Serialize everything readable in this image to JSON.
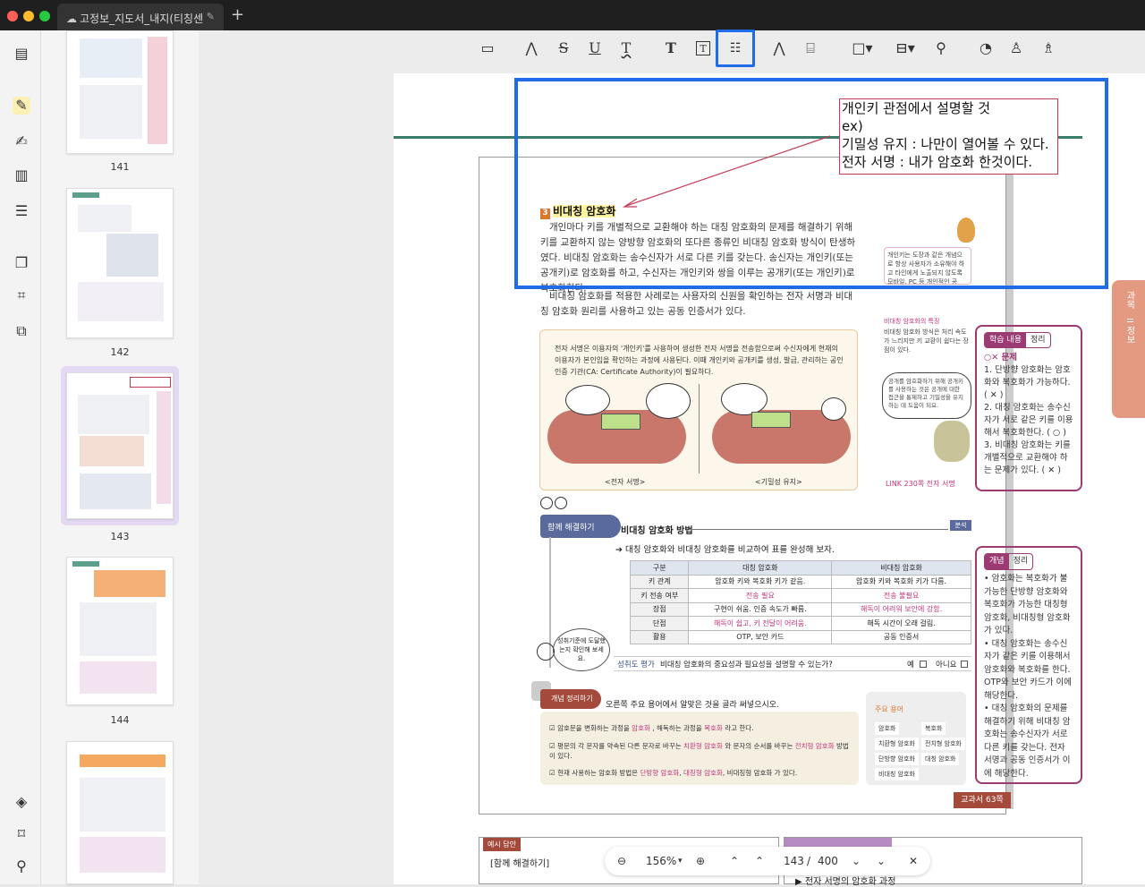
{
  "window": {
    "tab_title": "고정보_지도서_내지(티칭센",
    "new_tab": "+"
  },
  "thumbnails": [
    {
      "label": "141"
    },
    {
      "label": "142"
    },
    {
      "label": "143"
    },
    {
      "label": "144"
    }
  ],
  "toolbar": {
    "tools": [
      "note-icon",
      "highlighter-icon",
      "strikethrough-icon",
      "underline-icon",
      "squiggly-icon",
      "text-icon",
      "textbox-icon",
      "callout-icon",
      "pencil-icon",
      "eraser-icon",
      "shape-icon",
      "measure-icon",
      "attachment-icon",
      "sticker-icon",
      "stamp-icon",
      "signature-icon"
    ]
  },
  "comment": {
    "line1": "개인키 관점에서 설명할 것",
    "line2": "ex)",
    "line3": "기밀성 유지 : 나만이 열어볼 수 있다.",
    "line4": "전자 서명 : 내가 암호화 한것이다."
  },
  "page": {
    "section_num": "3",
    "section_title": "비대칭 암호화",
    "para1": "개인마다 키를 개별적으로 교환해야 하는 대칭 암호화의 문제를 해결하기 위해 키를 교환하지 않는 양방향 암호화의 또다른 종류인 비대칭 암호화 방식이 탄생하였다. 비대칭 암호화는 송수신자가 서로 다른 키를 갖는다. 송신자는 개인키(또는 공개키)로 암호화를 하고, 수신자는 개인키와 쌍을 이루는 공개키(또는 개인키)로 복호화한다.",
    "para2": "비대칭 암호화를 적용한 사례로는 사용자의 신원을 확인하는 전자 서명과 비대칭 암호화 원리를 사용하고 있는 공동 인증서가 있다.",
    "sidenote1": "개인키는 도장과 같은 개념으로 항상 사용자가 소유해야 하고 타인에게 노출되지 않도록 모바일, PC 등 개인적인 공",
    "sidenote2_title": "비대칭 암호화의 특징",
    "sidenote2": "비대칭 암호화 방식은 처리 속도가 느리지만 키 교환이 쉽다는 장점이 있다.",
    "bubble_side": "공개를 암호화하기 위해 공개키를 사용하는 것은 공개에 대한 접근을 통제하고 기밀성을 유지하는 데 도움이 되요.",
    "link_text": "LINK 230쪽 전자 서명",
    "tab_side_a": "과목",
    "tab_side_b": "II 정보",
    "cartoon_text": "전자 서명은 이용자의 '개인키'를 사용하여 생성한 전자 서명을 전송함으로써 수신자에게 현재의 이용자가 본인임을 확인하는 과정에 사용된다. 이때 개인키와 공개키를 생성, 발급, 관리하는 공인 인증 기관(CA: Certificate Authority)이 필요하다.",
    "cartoon_lbl1": "<전자 서명>",
    "cartoon_lbl2": "<기밀성 유지>",
    "boxA_pill_a": "학습 내용",
    "boxA_pill_b": "정리",
    "boxA_title": "○✕ 문제",
    "boxA_items": [
      "1. 단방향 암호화는 암호화와 복호화가 가능하다. ( ✕ )",
      "2. 대칭 암호화는 송수신자가 서로 같은 키를 이용해서 복호화한다. ( ○ )",
      "3. 비대칭 암호화는 키를 개별적으로 교환해야 하는 문제가 있다. ( ✕ )"
    ],
    "boxB_pill_a": "개념",
    "boxB_pill_b": "정리",
    "boxB_items": [
      "• 암호화는 복호화가 불가능한 단방향 암호화와 복호화가 가능한 대칭형 암호화, 비대칭형 암호화가 있다.",
      "• 대칭 암호화는 송수신자가 같은 키를 이용해서 암호화와 복호화를 한다. OTP와 보안 카드가 이에 해당한다.",
      "• 대칭 암호화의 문제를 해결하기 위해 비대칭 암호화는 송수신자가 서로 다른 키를 갖는다. 전자 서명과 공동 인증서가 이에 해당한다."
    ],
    "solve_label": "함께 해결하기",
    "solve_title": "비대칭 암호화 방법",
    "solve_badge": "분석",
    "solve_task": "대칭 암호화와 비대칭 암호화를 비교하여 표를 완성해 보자.",
    "table_head": [
      "구분",
      "대칭 암호화",
      "비대칭 암호화"
    ],
    "table_rows": [
      [
        "키 관계",
        "암호화 키와 복호화 키가 같음.",
        "암호화 키와 복호화 키가 다름."
      ],
      [
        "키 전송 여부",
        "전송 필요",
        "전송 불필요"
      ],
      [
        "장점",
        "구현이 쉬움. 인증 속도가 빠름.",
        "해독이 어려워 보안에 강함."
      ],
      [
        "단점",
        "해독이 쉽고, 키 전달이 어려움.",
        "해독 시간이 오래 걸림."
      ],
      [
        "활용",
        "OTP, 보안 카드",
        "공동 인증서"
      ]
    ],
    "eval_label": "성취도 평가",
    "eval_q": "비대칭 암호화의 중요성과 필요성을 설명할 수 있는가?",
    "eval_yes": "예",
    "eval_no": "아니요",
    "eval_bubble": "성취기준에 도달했는지 확인해 보세요.",
    "summary_label": "개념 정리하기",
    "summary_task": "오른쪽 주요 용어에서 알맞은 것을 골라 써넣으시오.",
    "summary_rows": [
      [
        "암호문을 변화하는 과정을",
        "암호화",
        ", 해독하는 과정을",
        "복호화",
        "라고 한다."
      ],
      [
        "평문의 각 문자를 약속된 다른 문자로 바꾸는",
        "치환형 암호화",
        "와 문자의 순서를 바꾸는",
        "전치형 암호화",
        "방법이 있다."
      ],
      [
        "현재 사용하는 암호화 방법은",
        "단방향 암호화",
        ",",
        "대칭형 암호화",
        ", 비대칭형 암호화 가 있다."
      ]
    ],
    "terms_title": "주요 용어",
    "terms": [
      "암호화",
      "복호화",
      "치환형 암호화",
      "전치형 암호화",
      "단방향 암호화",
      "대칭 암호화",
      "비대칭 암호화"
    ],
    "badge_page": "교과서 63쪽",
    "lower_tag": "예시 답안",
    "lower_title": "[함께 해결하기]",
    "lower_right": "▶ 전자 서명의 암호화 과정"
  },
  "bottombar": {
    "zoom": "156%",
    "page_current": "143",
    "page_sep": "/",
    "page_total": "400"
  },
  "colors": {
    "selection": "#1f6bea",
    "comment_border": "#c23b55",
    "accent_purple": "#9c3a73"
  }
}
